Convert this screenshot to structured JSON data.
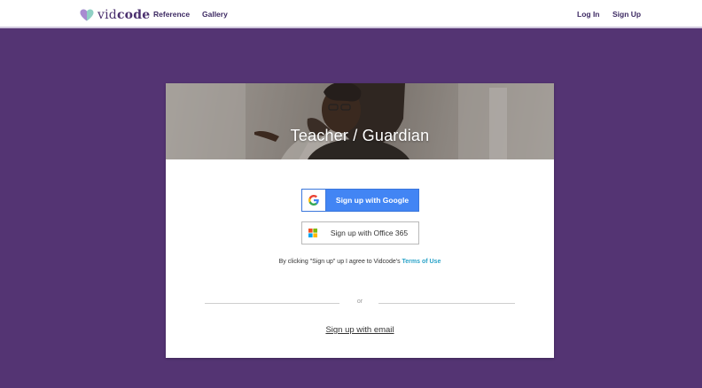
{
  "nav": {
    "logo_text_light": "vid",
    "logo_text_bold": "code",
    "links": [
      "Reference",
      "Gallery"
    ],
    "login": "Log In",
    "signup": "Sign Up"
  },
  "card": {
    "title": "Teacher / Guardian",
    "google_label": "Sign up with Google",
    "office_label": "Sign up with Office 365",
    "terms_prefix": "By clicking \"Sign up\" up I agree to Vidcode's ",
    "terms_link": "Terms of Use",
    "divider_text": "or",
    "email_link": "Sign up with email"
  },
  "colors": {
    "hero_background": "#543473",
    "google_blue": "#4285f4",
    "link_teal": "#2aa3c8",
    "logo_purple": "#4a2f6e"
  },
  "icons": [
    "heart-logo-icon",
    "google-g-icon",
    "office-365-icon"
  ]
}
